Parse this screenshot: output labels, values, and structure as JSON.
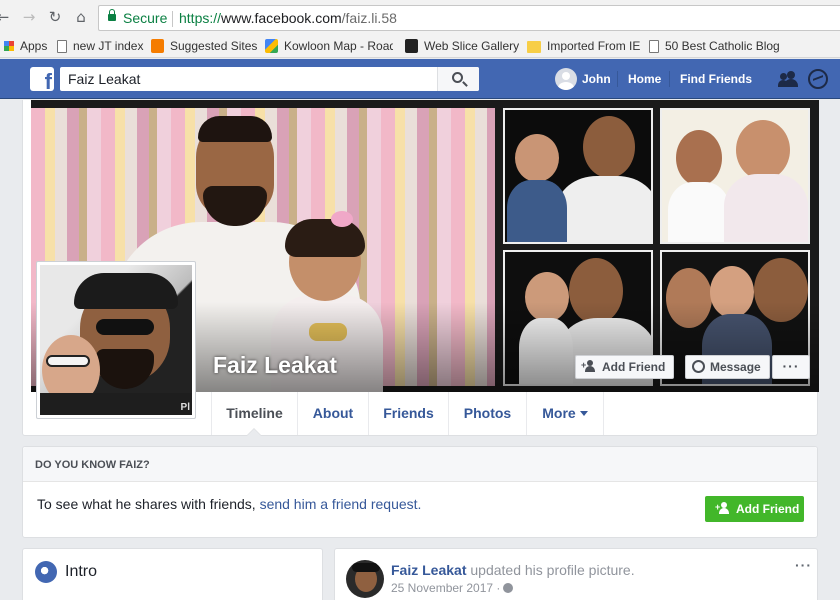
{
  "browser": {
    "secure_label": "Secure",
    "url_protocol": "https://",
    "url_host": "www.facebook.com",
    "url_path": "/faiz.li.58",
    "bookmarks": [
      {
        "label": "Apps",
        "icon": "apps-grid-icon"
      },
      {
        "label": "new JT index",
        "icon": "page-icon"
      },
      {
        "label": "Suggested Sites",
        "icon": "suggested-sites-icon"
      },
      {
        "label": "Kowloon Map - Road",
        "icon": "map-icon"
      },
      {
        "label": "Web Slice Gallery",
        "icon": "web-slice-icon"
      },
      {
        "label": "Imported From IE",
        "icon": "folder-icon"
      },
      {
        "label": "50 Best Catholic Blog",
        "icon": "page-icon"
      }
    ]
  },
  "facebook": {
    "search_value": "Faiz Leakat",
    "user_name": "John",
    "nav": {
      "home": "Home",
      "find_friends": "Find Friends"
    },
    "colors": {
      "brand_blue": "#4267b2",
      "link_blue": "#365899",
      "green": "#42b72a"
    }
  },
  "profile": {
    "name": "Faiz Leakat",
    "avatar_badge": "Pl",
    "actions": {
      "add_friend": "Add Friend",
      "message": "Message",
      "more": "···"
    },
    "tabs": [
      {
        "label": "Timeline",
        "active": true
      },
      {
        "label": "About"
      },
      {
        "label": "Friends"
      },
      {
        "label": "Photos"
      },
      {
        "label": "More"
      }
    ]
  },
  "know_card": {
    "title": "DO YOU KNOW FAIZ?",
    "text": "To see what he shares with friends,",
    "link": "send him a friend request.",
    "button": "Add Friend"
  },
  "intro": {
    "title": "Intro"
  },
  "post": {
    "author": "Faiz Leakat",
    "action": "updated his profile picture.",
    "date": "25 November 2017 ·",
    "more": "···"
  }
}
